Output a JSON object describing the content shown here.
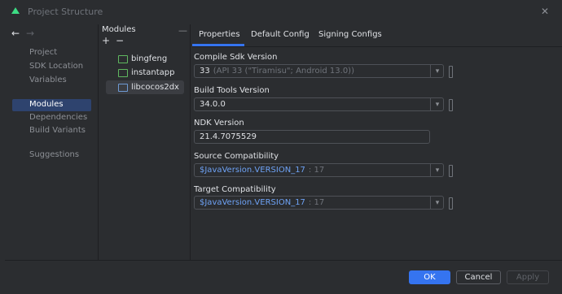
{
  "window": {
    "title": "Project Structure",
    "close_glyph": "✕"
  },
  "nav": {
    "back_glyph": "←",
    "forward_glyph": "→"
  },
  "sidebar": {
    "items": [
      {
        "label": "Project"
      },
      {
        "label": "SDK Location"
      },
      {
        "label": "Variables"
      },
      {
        "label": "Modules",
        "selected": true
      },
      {
        "label": "Dependencies"
      },
      {
        "label": "Build Variants"
      },
      {
        "label": "Suggestions"
      }
    ]
  },
  "modules": {
    "header": "Modules",
    "add_glyph": "+",
    "remove_glyph": "−",
    "collapse_glyph": "—",
    "items": [
      {
        "label": "bingfeng"
      },
      {
        "label": "instantapp"
      },
      {
        "label": "libcocos2dx",
        "selected": true
      }
    ]
  },
  "tabs": [
    {
      "label": "Properties",
      "active": true
    },
    {
      "label": "Default Config"
    },
    {
      "label": "Signing Configs"
    }
  ],
  "fields": {
    "compile_sdk": {
      "label": "Compile Sdk Version",
      "value": "33",
      "hint": "(API 33 (\"Tiramisu\"; Android 13.0))"
    },
    "build_tools": {
      "label": "Build Tools Version",
      "value": "34.0.0"
    },
    "ndk": {
      "label": "NDK Version",
      "value": "21.4.7075529"
    },
    "source_compat": {
      "label": "Source Compatibility",
      "value": "$JavaVersion.VERSION_17",
      "hint": ": 17"
    },
    "target_compat": {
      "label": "Target Compatibility",
      "value": "$JavaVersion.VERSION_17",
      "hint": ": 17"
    }
  },
  "buttons": {
    "ok": "OK",
    "cancel": "Cancel",
    "apply": "Apply"
  },
  "colors": {
    "accent": "#3574f0",
    "selection": "#2e436e",
    "background": "#2b2d30"
  }
}
